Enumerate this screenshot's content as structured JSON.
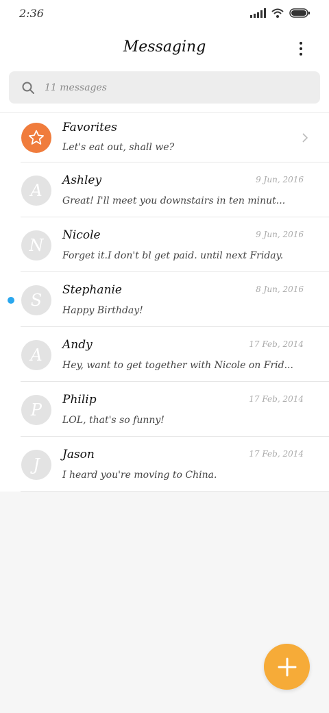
{
  "status_bar": {
    "time": "2:36"
  },
  "header": {
    "title": "Messaging"
  },
  "search": {
    "placeholder": "11 messages"
  },
  "colors": {
    "favorites_avatar": "#f07c3c",
    "unread_dot": "#2aa7ee",
    "fab": "#f6ab38"
  },
  "favorites": {
    "name": "Favorites",
    "preview": "Let's eat out, shall we?"
  },
  "conversations": [
    {
      "initial": "A",
      "name": "Ashley",
      "date": "9 Jun, 2016",
      "preview": "Great! I'll meet you downstairs in ten minut...",
      "unread": false
    },
    {
      "initial": "N",
      "name": "Nicole",
      "date": "9 Jun, 2016",
      "preview": "Forget it.I don't bl get paid. until next Friday.",
      "unread": false
    },
    {
      "initial": "S",
      "name": "Stephanie",
      "date": "8 Jun, 2016",
      "preview": "Happy Birthday!",
      "unread": true
    },
    {
      "initial": "A",
      "name": "Andy",
      "date": "17 Feb, 2014",
      "preview": "Hey, want to get together with Nicole on Frid...",
      "unread": false
    },
    {
      "initial": "P",
      "name": "Philip",
      "date": "17 Feb, 2014",
      "preview": "LOL, that's so funny!",
      "unread": false
    },
    {
      "initial": "J",
      "name": "Jason",
      "date": "17 Feb, 2014",
      "preview": "I heard you're moving to China.",
      "unread": false
    }
  ]
}
